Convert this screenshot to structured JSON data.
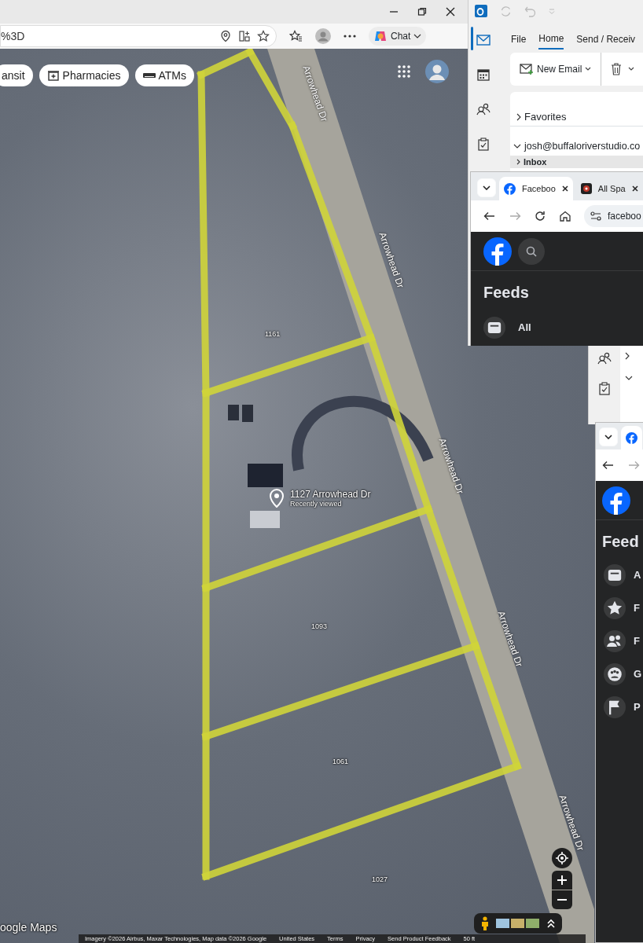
{
  "browser": {
    "url_fragment": "%3D",
    "chat_button": "Chat"
  },
  "map": {
    "chips": [
      {
        "label": "ansit",
        "kind": "transit"
      },
      {
        "label": "Pharmacies",
        "kind": "pharmacy"
      },
      {
        "label": "ATMs",
        "kind": "atm"
      }
    ],
    "road_labels": [
      "Arrowhead Dr",
      "Arrowhead Dr",
      "Arrowhead Dr",
      "Arrowhead Dr",
      "Arrowhead Dr"
    ],
    "parcel_labels": [
      "1161",
      "1093",
      "1061",
      "1027"
    ],
    "place": {
      "name": "1127 Arrowhead Dr",
      "subtitle": "Recently viewed"
    },
    "logo": "oogle Maps",
    "attribution": [
      "Imagery ©2026 Airbus, Maxar Technologies, Map data ©2026 Google",
      "United States",
      "Terms",
      "Privacy",
      "Send Product Feedback",
      "50 ft"
    ]
  },
  "outlook": {
    "rail": [
      {
        "kind": "mail",
        "selected": true
      },
      {
        "kind": "calendar",
        "selected": false
      },
      {
        "kind": "people",
        "selected": false
      },
      {
        "kind": "tasks",
        "selected": false
      }
    ],
    "tabs": [
      {
        "label": "File",
        "selected": false
      },
      {
        "label": "Home",
        "selected": true
      },
      {
        "label": "Send / Receiv",
        "selected": false
      }
    ],
    "new_email": "New Email",
    "favorites": "Favorites",
    "account": "josh@buffaloriverstudio.co",
    "inbox": "Inbox"
  },
  "facebook_window": {
    "tabs": [
      {
        "label": "Faceboo",
        "kind": "facebook",
        "selected": true
      },
      {
        "label": "All Spa",
        "kind": "other",
        "selected": false
      }
    ],
    "url": "faceboo",
    "heading": "Feeds",
    "feeds": [
      {
        "label": "All",
        "kind": "all"
      }
    ]
  },
  "facebook_window_2": {
    "heading": "Feed",
    "feeds": [
      {
        "label": "A",
        "kind": "all"
      },
      {
        "label": "F",
        "kind": "favorites"
      },
      {
        "label": "F",
        "kind": "friends"
      },
      {
        "label": "G",
        "kind": "groups"
      },
      {
        "label": "P",
        "kind": "pages"
      }
    ]
  }
}
